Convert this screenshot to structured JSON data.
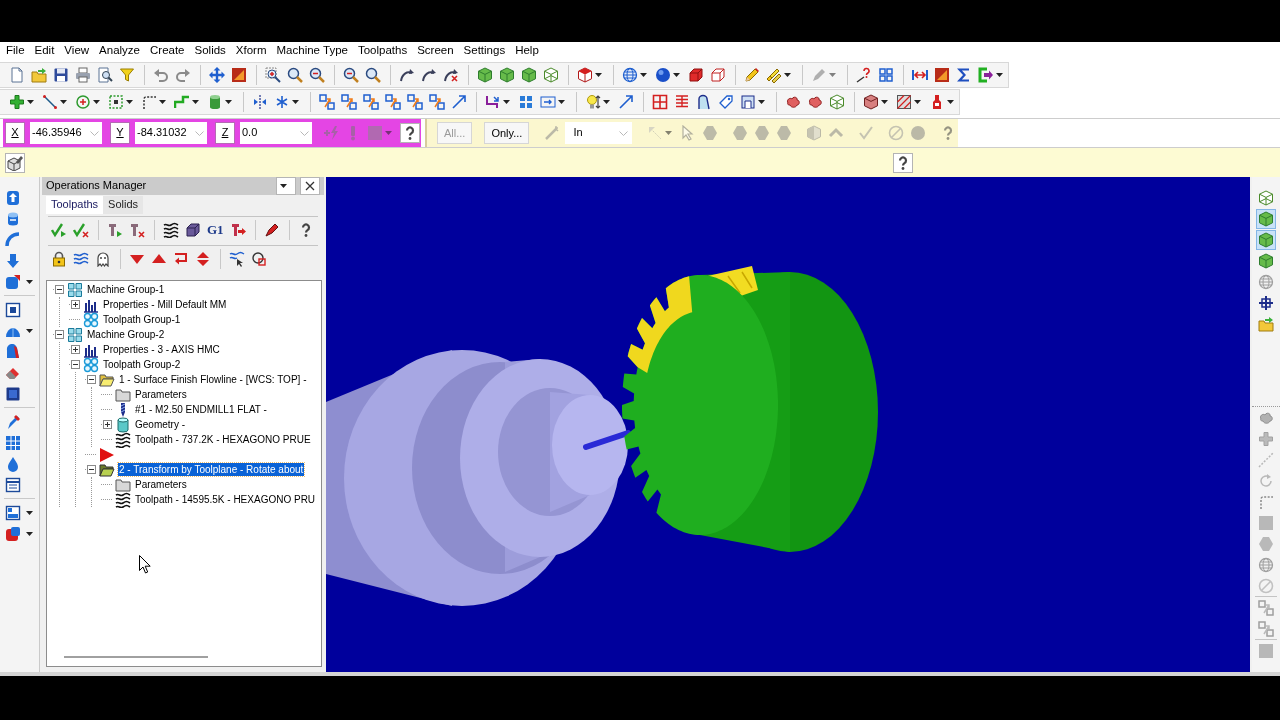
{
  "menu": [
    "File",
    "Edit",
    "View",
    "Analyze",
    "Create",
    "Solids",
    "Xform",
    "Machine Type",
    "Toolpaths",
    "Screen",
    "Settings",
    "Help"
  ],
  "coordinate_bar": {
    "fields": [
      {
        "label": "X",
        "value": "-46.35946"
      },
      {
        "label": "Y",
        "value": "-84.31032"
      },
      {
        "label": "Z",
        "value": "0.0"
      }
    ]
  },
  "selection_bar": {
    "buttons": [
      {
        "label": "All...",
        "disabled": true
      },
      {
        "label": "Only...",
        "disabled": false
      }
    ],
    "mode": "In"
  },
  "operations_manager": {
    "title": "Operations Manager",
    "tabs": [
      {
        "label": "Toolpaths",
        "selected": true
      },
      {
        "label": "Solids",
        "selected": false
      }
    ],
    "toolbar_label": "G1",
    "tree": [
      {
        "kind": "machine-group",
        "label": "Machine Group-1",
        "expanded": true,
        "selected": false,
        "children": [
          {
            "kind": "properties",
            "label": "Properties - Mill Default MM",
            "expanded": false,
            "selected": false
          },
          {
            "kind": "toolpath-group",
            "label": "Toolpath Group-1",
            "selected": false
          }
        ]
      },
      {
        "kind": "machine-group",
        "label": "Machine Group-2",
        "expanded": true,
        "selected": false,
        "children": [
          {
            "kind": "properties",
            "label": "Properties - 3 - AXIS HMC",
            "expanded": false,
            "selected": false
          },
          {
            "kind": "toolpath-group",
            "label": "Toolpath Group-2",
            "expanded": true,
            "selected": false,
            "children": [
              {
                "kind": "operation",
                "label": "1 - Surface Finish Flowline - [WCS: TOP] -",
                "expanded": true,
                "selected": false,
                "children": [
                  {
                    "kind": "parameters",
                    "label": "Parameters",
                    "selected": false
                  },
                  {
                    "kind": "tool",
                    "label": "#1 - M2.50 ENDMILL1 FLAT -",
                    "selected": false
                  },
                  {
                    "kind": "geometry",
                    "label": "Geometry -",
                    "expanded": false,
                    "selected": false
                  },
                  {
                    "kind": "toolpath",
                    "label": "Toolpath - 737.2K - HEXAGONO PRUE",
                    "selected": false
                  }
                ]
              },
              {
                "kind": "insert-marker",
                "selected": false
              },
              {
                "kind": "transform-operation",
                "label": "2 - Transform by Toolplane - Rotate about",
                "expanded": true,
                "selected": true,
                "children": [
                  {
                    "kind": "parameters",
                    "label": "Parameters",
                    "selected": false
                  },
                  {
                    "kind": "toolpath",
                    "label": "Toolpath - 14595.5K - HEXAGONO PRU",
                    "selected": false
                  }
                ]
              }
            ]
          }
        ]
      }
    ]
  },
  "right_toolbar": [
    {
      "pressed": false
    },
    {
      "pressed": true
    },
    {
      "pressed": true
    },
    {
      "pressed": false
    },
    {
      "pressed": false
    },
    {
      "pressed": false
    },
    {
      "pressed": false
    }
  ]
}
